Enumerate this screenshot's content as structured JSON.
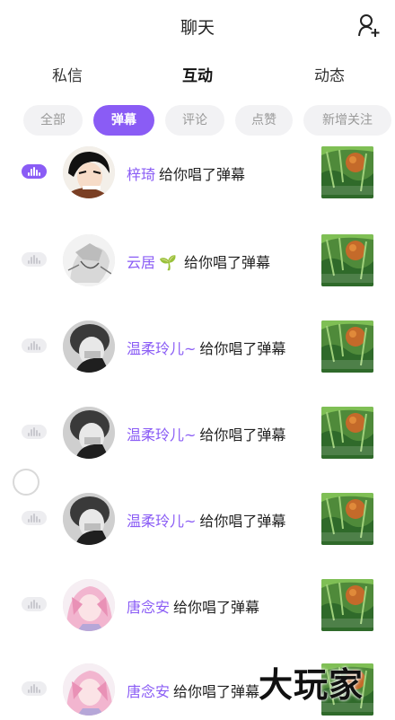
{
  "header": {
    "title": "聊天"
  },
  "tabs": [
    {
      "label": "私信",
      "active": false
    },
    {
      "label": "互动",
      "active": true
    },
    {
      "label": "动态",
      "active": false
    }
  ],
  "filters": [
    {
      "label": "全部",
      "active": false
    },
    {
      "label": "弹幕",
      "active": true
    },
    {
      "label": "评论",
      "active": false
    },
    {
      "label": "点赞",
      "active": false
    },
    {
      "label": "新增关注",
      "active": false
    }
  ],
  "notifications": [
    {
      "name": "梓琦",
      "message": "给你唱了弹幕",
      "voice_active": true,
      "emoji": "",
      "avatar": "anime-boy"
    },
    {
      "name": "云居",
      "message": "给你唱了弹幕",
      "voice_active": false,
      "emoji": "🌱",
      "avatar": "sketch"
    },
    {
      "name": "温柔玲儿~",
      "message": "给你唱了弹幕",
      "voice_active": false,
      "emoji": "",
      "avatar": "bw-photo"
    },
    {
      "name": "温柔玲儿~",
      "message": "给你唱了弹幕",
      "voice_active": false,
      "emoji": "",
      "avatar": "bw-photo"
    },
    {
      "name": "温柔玲儿~",
      "message": "给你唱了弹幕",
      "voice_active": false,
      "emoji": "",
      "avatar": "bw-photo"
    },
    {
      "name": "唐念安",
      "message": "给你唱了弹幕",
      "voice_active": false,
      "emoji": "",
      "avatar": "pink-anime"
    },
    {
      "name": "唐念安",
      "message": "给你唱了弹幕",
      "voice_active": false,
      "emoji": "",
      "avatar": "pink-anime"
    }
  ],
  "watermark": "大玩家",
  "colors": {
    "accent": "#8a5cf5",
    "tab_highlight": "#f5d34b"
  }
}
